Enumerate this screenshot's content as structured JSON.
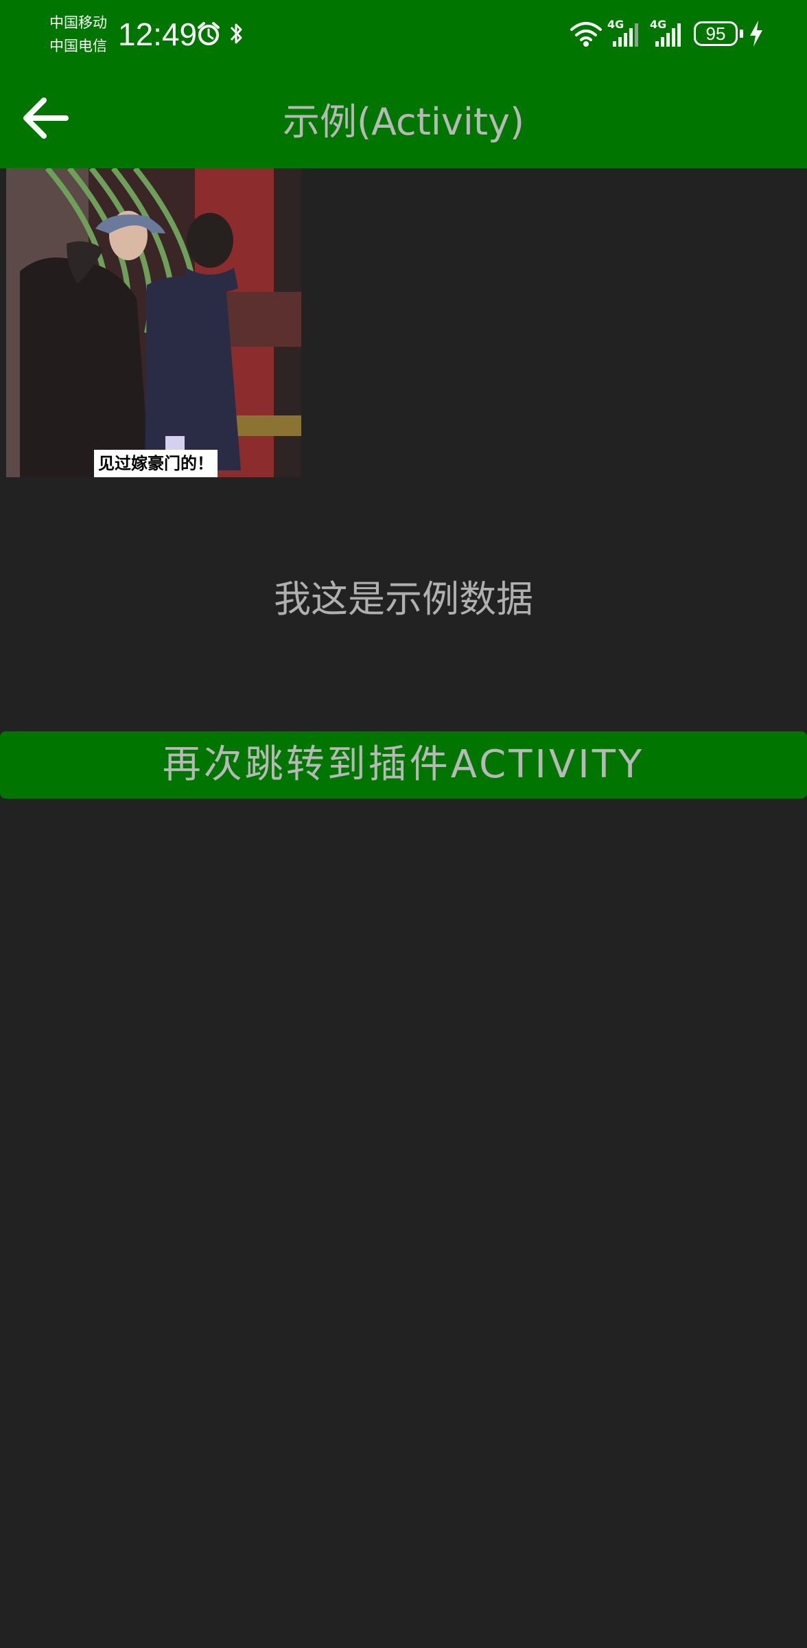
{
  "status_bar": {
    "carrier_1": "中国移动",
    "carrier_2": "中国电信",
    "time": "12:49",
    "battery_level": "95",
    "network_1": "4G",
    "network_2": "4G",
    "icons": [
      "alarm-icon",
      "bluetooth-icon",
      "wifi-icon",
      "signal-icon",
      "signal-icon",
      "charging-icon"
    ]
  },
  "toolbar": {
    "title": "示例(Activity)",
    "back_icon": "arrow-left-icon"
  },
  "content": {
    "image_caption": "见过嫁豪门的！",
    "sample_text": "我这是示例数据",
    "button_label": "再次跳转到插件ACTIVITY"
  },
  "colors": {
    "header": "#007500",
    "background": "#222222",
    "text": "#b0b0b0"
  }
}
